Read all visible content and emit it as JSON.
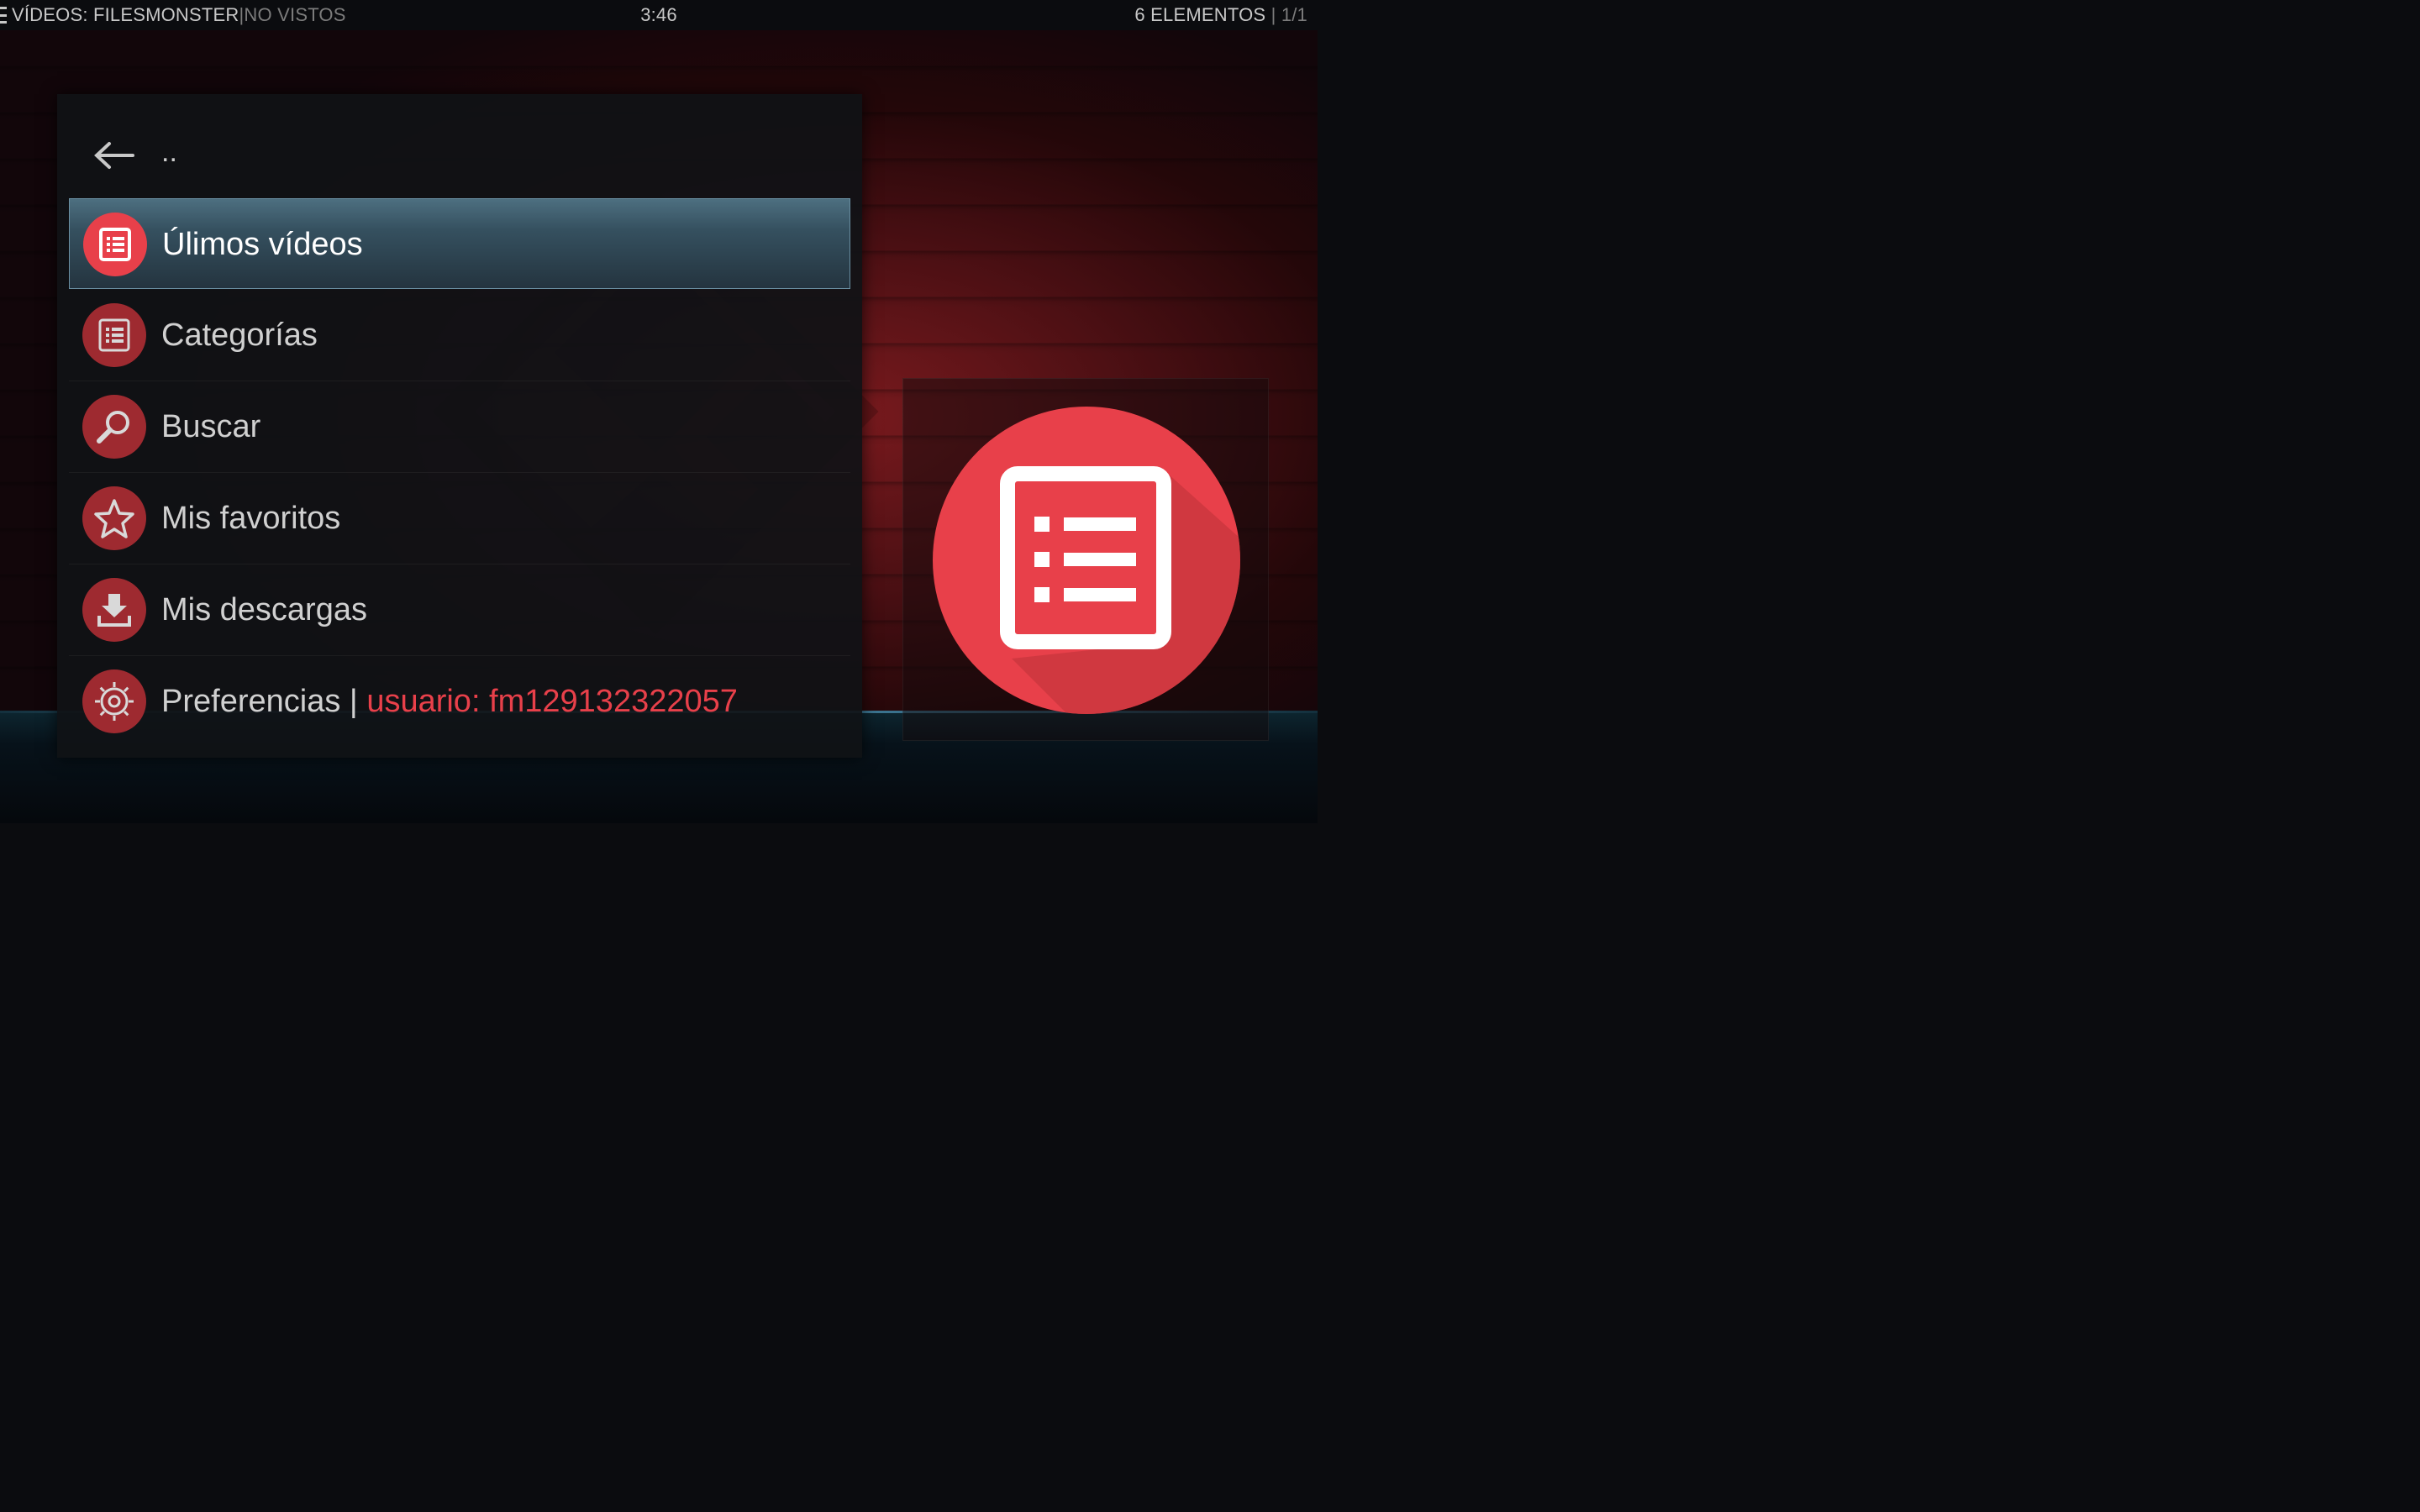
{
  "header": {
    "section": "VÍDEOS: FILESMONSTER",
    "separator": " | ",
    "filter": "NO VISTOS",
    "clock": "3:46",
    "count": "6 ELEMENTOS",
    "page": "1/1"
  },
  "list": {
    "parent_label": "..",
    "items": [
      {
        "label": "Úlimos vídeos",
        "icon": "list-icon",
        "selected": true
      },
      {
        "label": "Categorías",
        "icon": "list-icon",
        "selected": false
      },
      {
        "label": "Buscar",
        "icon": "search-icon",
        "selected": false
      },
      {
        "label": "Mis favoritos",
        "icon": "star-icon",
        "selected": false
      },
      {
        "label": "Mis descargas",
        "icon": "download-icon",
        "selected": false
      },
      {
        "label": "Preferencias | ",
        "user": "usuario: fm129132322057",
        "icon": "gear-icon",
        "selected": false
      }
    ]
  },
  "thumbnail": {
    "icon": "list-icon"
  },
  "colors": {
    "accent_red": "#e8404a",
    "icon_red_dim": "#9e2a30",
    "selection_blue": "#4d6f80"
  }
}
